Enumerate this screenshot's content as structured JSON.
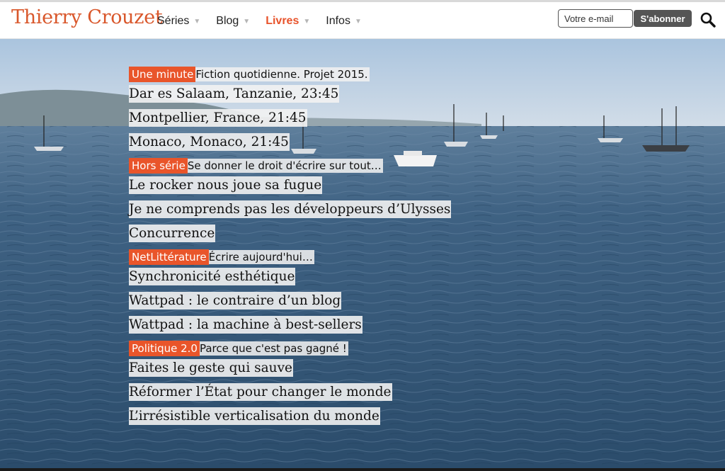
{
  "site": {
    "title": "Thierry Crouzet"
  },
  "nav": [
    {
      "label": "Séries",
      "active": false
    },
    {
      "label": "Blog",
      "active": false
    },
    {
      "label": "Livres",
      "active": true
    },
    {
      "label": "Infos",
      "active": false
    }
  ],
  "nav_caret": "▼",
  "newsletter": {
    "placeholder": "Votre e-mail",
    "button_label": "S'abonner"
  },
  "colors": {
    "accent": "#e9552a",
    "logo": "#d9572b",
    "button": "#555555"
  },
  "sections": [
    {
      "tag": "Une minute",
      "description": "Fiction quotidienne. Projet 2015.",
      "articles": [
        "Dar es Salaam, Tanzanie, 23:45",
        "Montpellier, France, 21:45",
        "Monaco, Monaco, 21:45"
      ]
    },
    {
      "tag": "Hors série",
      "description": "Se donner le droit d'écrire sur tout…",
      "articles": [
        "Le rocker nous joue sa fugue",
        "Je ne comprends pas les développeurs d’Ulysses",
        "Concurrence"
      ]
    },
    {
      "tag": "NetLittérature",
      "description": "Écrire aujourd'hui…",
      "articles": [
        "Synchronicité esthétique",
        "Wattpad : le contraire d’un blog",
        "Wattpad : la machine à best-sellers"
      ]
    },
    {
      "tag": "Politique 2.0",
      "description": "Parce que c'est pas gagné !",
      "articles": [
        "Faites le geste qui sauve",
        "Réformer l’État pour changer le monde",
        "L’irrésistible verticalisation du monde"
      ]
    }
  ],
  "icons": {
    "search": "search-icon"
  }
}
